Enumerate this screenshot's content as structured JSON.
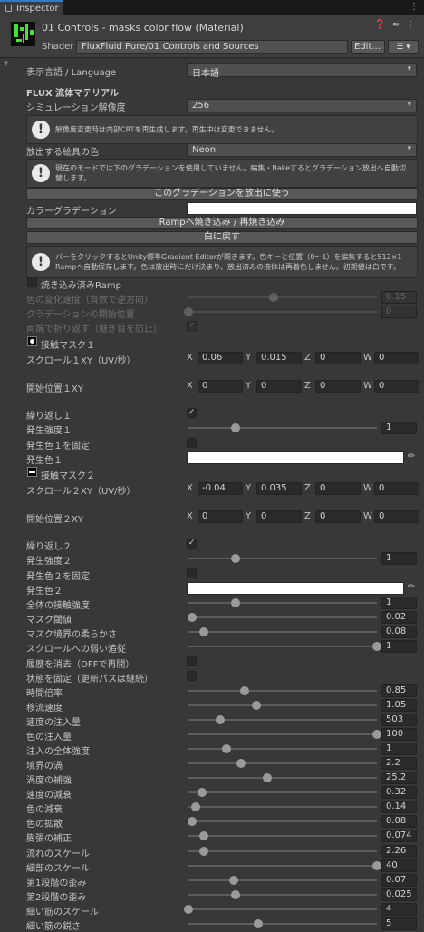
{
  "window": {
    "tab_label": "Inspector"
  },
  "material": {
    "title": "01 Controls - masks color flow (Material)",
    "shader_label": "Shader",
    "shader_value": "FluxFluid Pure/01 Controls and Sources",
    "edit_label": "Edit...",
    "menu_label": "☰ ▾"
  },
  "props": {
    "language": {
      "label": "表示言語 / Language",
      "value": "日本語"
    },
    "section_title": "FLUX 流体マテリアル",
    "resolution": {
      "label": "シミュレーション解像度",
      "value": "256"
    },
    "help1": "解像度変更時は内部CRTを再生成します。再生中は変更できません。",
    "paint_color": {
      "label": "放出する絵具の色",
      "value": "Neon"
    },
    "help2": "現在のモードでは下のグラデーションを使用していません。編集・Bakeするとグラデーション放出へ自動切替します。",
    "use_gradient_btn": "このグラデーションを放出に使う",
    "color_gradient_label": "カラーグラデーション",
    "bake_btn": "Rampへ焼き込み / 再焼き込み",
    "reset_white_btn": "白に戻す",
    "help3": "バーをクリックするとUnity標準Gradient Editorが開きます。色キーと位置（0〜1）を編集すると512×1 Rampへ自動保存します。色は放出時にだけ決まり、放出済みの液体は再着色しません。初期値は白です。",
    "baked_ramp_label": "焼き込み済みRamp",
    "color_speed": {
      "label": "色の変化速度（負数で逆方向）",
      "value": "0.15",
      "level": 0.45
    },
    "gradient_start": {
      "label": "グラデーションの開始位置",
      "value": "0",
      "level": 0.0
    },
    "pingpong_label": "両端で折り返す（継ぎ目を防止）",
    "mask1_label": "接触マスク１",
    "scroll1": {
      "label": "スクロール１XY（UV/秒）",
      "x": "0.06",
      "y": "0.015",
      "z": "0",
      "w": "0"
    },
    "offset1": {
      "label": "開始位置１XY",
      "x": "0",
      "y": "0",
      "z": "0",
      "w": "0"
    },
    "repeat1_label": "繰り返し１",
    "intensity1": {
      "label": "発生強度１",
      "value": "1",
      "level": 0.25
    },
    "fixcolor1_label": "発生色１を固定",
    "color1_label": "発生色１",
    "mask2_label": "接触マスク２",
    "scroll2": {
      "label": "スクロール２XY（UV/秒）",
      "x": "-0.04",
      "y": "0.035",
      "z": "0",
      "w": "0"
    },
    "offset2": {
      "label": "開始位置２XY",
      "x": "0",
      "y": "0",
      "z": "0",
      "w": "0"
    },
    "repeat2_label": "繰り返し２",
    "intensity2": {
      "label": "発生強度２",
      "value": "1",
      "level": 0.25
    },
    "fixcolor2_label": "発生色２を固定",
    "color2_label": "発生色２",
    "global_contact": {
      "label": "全体の接触強度",
      "value": "1",
      "level": 0.25
    },
    "mask_threshold": {
      "label": "マスク閾値",
      "value": "0.02",
      "level": 0.02
    },
    "mask_softness": {
      "label": "マスク境界の柔らかさ",
      "value": "0.08",
      "level": 0.08
    },
    "scroll_follow": {
      "label": "スクロールへの弱い追従",
      "value": "1",
      "level": 1.0
    },
    "clear_history_label": "履歴を消去（OFFで再開）",
    "freeze_state_label": "状態を固定（更新パスは継続）",
    "time_scale": {
      "label": "時間倍率",
      "value": "0.85",
      "level": 0.3
    },
    "advection_speed": {
      "label": "移流速度",
      "value": "1.05",
      "level": 0.36
    },
    "velocity_injection": {
      "label": "速度の注入量",
      "value": "503",
      "level": 0.17
    },
    "color_injection": {
      "label": "色の注入量",
      "value": "100",
      "level": 1.0
    },
    "injection_strength": {
      "label": "注入の全体強度",
      "value": "1",
      "level": 0.2
    },
    "boundary_vortex": {
      "label": "境界の渦",
      "value": "2.2",
      "level": 0.28
    },
    "vorticity": {
      "label": "渦度の補強",
      "value": "25.2",
      "level": 0.42
    },
    "velocity_decay": {
      "label": "速度の減衰",
      "value": "0.32",
      "level": 0.07
    },
    "color_decay": {
      "label": "色の減衰",
      "value": "0.14",
      "level": 0.04
    },
    "color_diffusion": {
      "label": "色の拡散",
      "value": "0.08",
      "level": 0.02
    },
    "expansion_fix": {
      "label": "膨張の補正",
      "value": "0.074",
      "level": 0.08
    },
    "flow_scale": {
      "label": "流れのスケール",
      "value": "2.26",
      "level": 0.08
    },
    "detail_scale": {
      "label": "細部のスケール",
      "value": "40",
      "level": 1.0
    },
    "warp1": {
      "label": "第1段階の歪み",
      "value": "0.07",
      "level": 0.24
    },
    "warp2": {
      "label": "第2段階の歪み",
      "value": "0.025",
      "level": 0.25
    },
    "fine_scale": {
      "label": "細い筋のスケール",
      "value": "4",
      "level": 0.0
    },
    "fine_sharp": {
      "label": "細い筋の鋭さ",
      "value": "5",
      "level": 0.37
    }
  }
}
